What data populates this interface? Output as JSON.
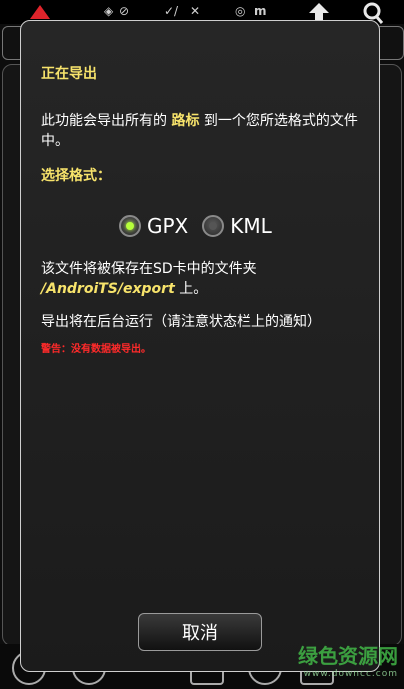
{
  "status_bar": {
    "icons": [
      "app-logo-icon",
      "gps-icon",
      "check-icon",
      "satellite-off-icon",
      "target-icon",
      "upload-icon",
      "map-pin-icon"
    ],
    "unit": "m"
  },
  "dialog": {
    "title": "正在导出",
    "description_part1": "此功能会导出所有的 ",
    "description_highlight": "路标",
    "description_part2": " 到一个您所选格式的文件中。",
    "format_label": "选择格式：",
    "formats": [
      {
        "label": "GPX",
        "checked": true
      },
      {
        "label": "KML",
        "checked": false
      }
    ],
    "save_note_prefix": "该文件将被保存在SD卡中的文件夹 ",
    "save_path": "/AndroiTS/export",
    "save_note_suffix": " 上。",
    "background_note": "导出将在后台运行（请注意状态栏上的通知）",
    "warning": "警告：没有数据被导出。",
    "cancel_label": "取消"
  },
  "watermark": {
    "text_cn": "绿色资源网",
    "text_en": "www.downcc.com"
  },
  "colors": {
    "accent_yellow": "#f7e36b",
    "warning_red": "#ff2a2a",
    "radio_checked": "#b6ff3a"
  }
}
